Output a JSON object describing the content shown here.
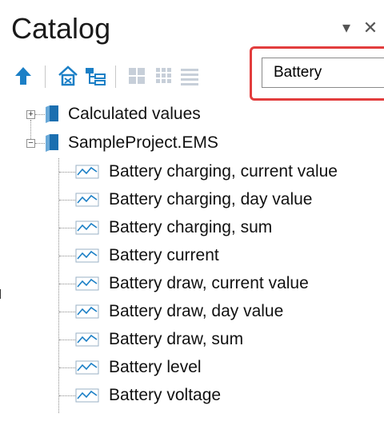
{
  "panel": {
    "title": "Catalog",
    "dropdown_glyph": "▾",
    "close_glyph": "✕"
  },
  "toolbar": {
    "buttons": [
      {
        "name": "up-arrow-icon"
      },
      {
        "name": "home-catalog-icon"
      },
      {
        "name": "tree-structure-icon"
      },
      {
        "name": "large-icons-view-icon"
      },
      {
        "name": "small-icons-view-icon"
      },
      {
        "name": "list-view-icon"
      }
    ],
    "search": {
      "value": "Battery",
      "placeholder": ""
    }
  },
  "colors": {
    "highlight": "#e23d3d",
    "icon_blue": "#1b7fc6",
    "tree_lines": "#8a8a8a"
  },
  "tree": {
    "folders": [
      {
        "label": "Calculated values",
        "state": "collapsed",
        "expander": "+"
      },
      {
        "label": "SampleProject.EMS",
        "state": "expanded",
        "expander": "−"
      }
    ],
    "items": [
      "Battery charging, current value",
      "Battery charging, day value",
      "Battery charging, sum",
      "Battery current",
      "Battery draw, current value",
      "Battery draw, day value",
      "Battery draw, sum",
      "Battery level",
      "Battery voltage"
    ]
  }
}
